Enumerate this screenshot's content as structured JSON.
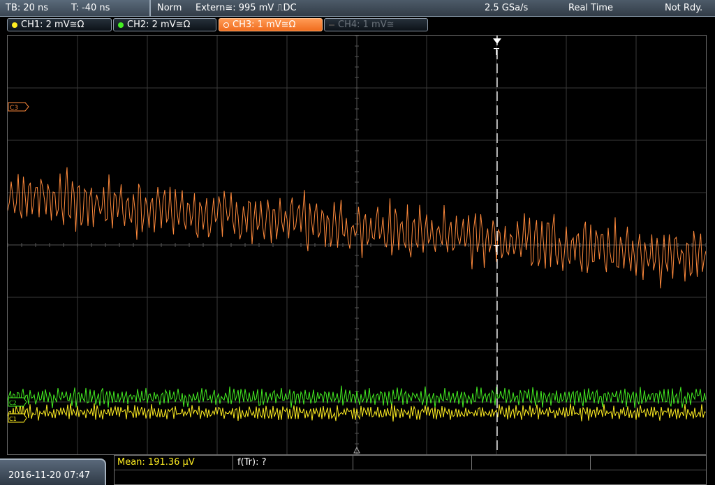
{
  "topbar": {
    "timebase": "TB: 20 ns",
    "trigger_offset": "T: -40 ns",
    "trigger_mode": "Norm",
    "trigger_source": "Extern≅: 995 mV ⎍DC",
    "sample_rate": "2.5 GSa/s",
    "acq_mode": "Real Time",
    "status": "Not Rdy."
  },
  "channels": [
    {
      "label": "CH1: 2 mV≅Ω",
      "color": "#ffee22",
      "state": "on"
    },
    {
      "label": "CH2: 2 mV≅Ω",
      "color": "#44ee22",
      "state": "on"
    },
    {
      "label": "CH3: 1 mV≅Ω",
      "color": "#ff8a3c",
      "state": "active"
    },
    {
      "label": "CH4: 1 mV≅",
      "color": "#555555",
      "state": "off"
    }
  ],
  "markers": {
    "trigger_top": "T",
    "trigger_mid": "T",
    "ch3_marker": "C3",
    "ch2_marker": "C2",
    "ch1_marker": "C1"
  },
  "bottom": {
    "datetime": "2016-11-20 07:47",
    "mean": "Mean: 191.36 µV",
    "ftr": "f(Tr): ?"
  },
  "colors": {
    "ch1": "#ffee22",
    "ch2": "#44ee22",
    "ch3": "#ff8a3c",
    "grid": "#3a3a3a",
    "trigger_line": "#ffffff"
  }
}
